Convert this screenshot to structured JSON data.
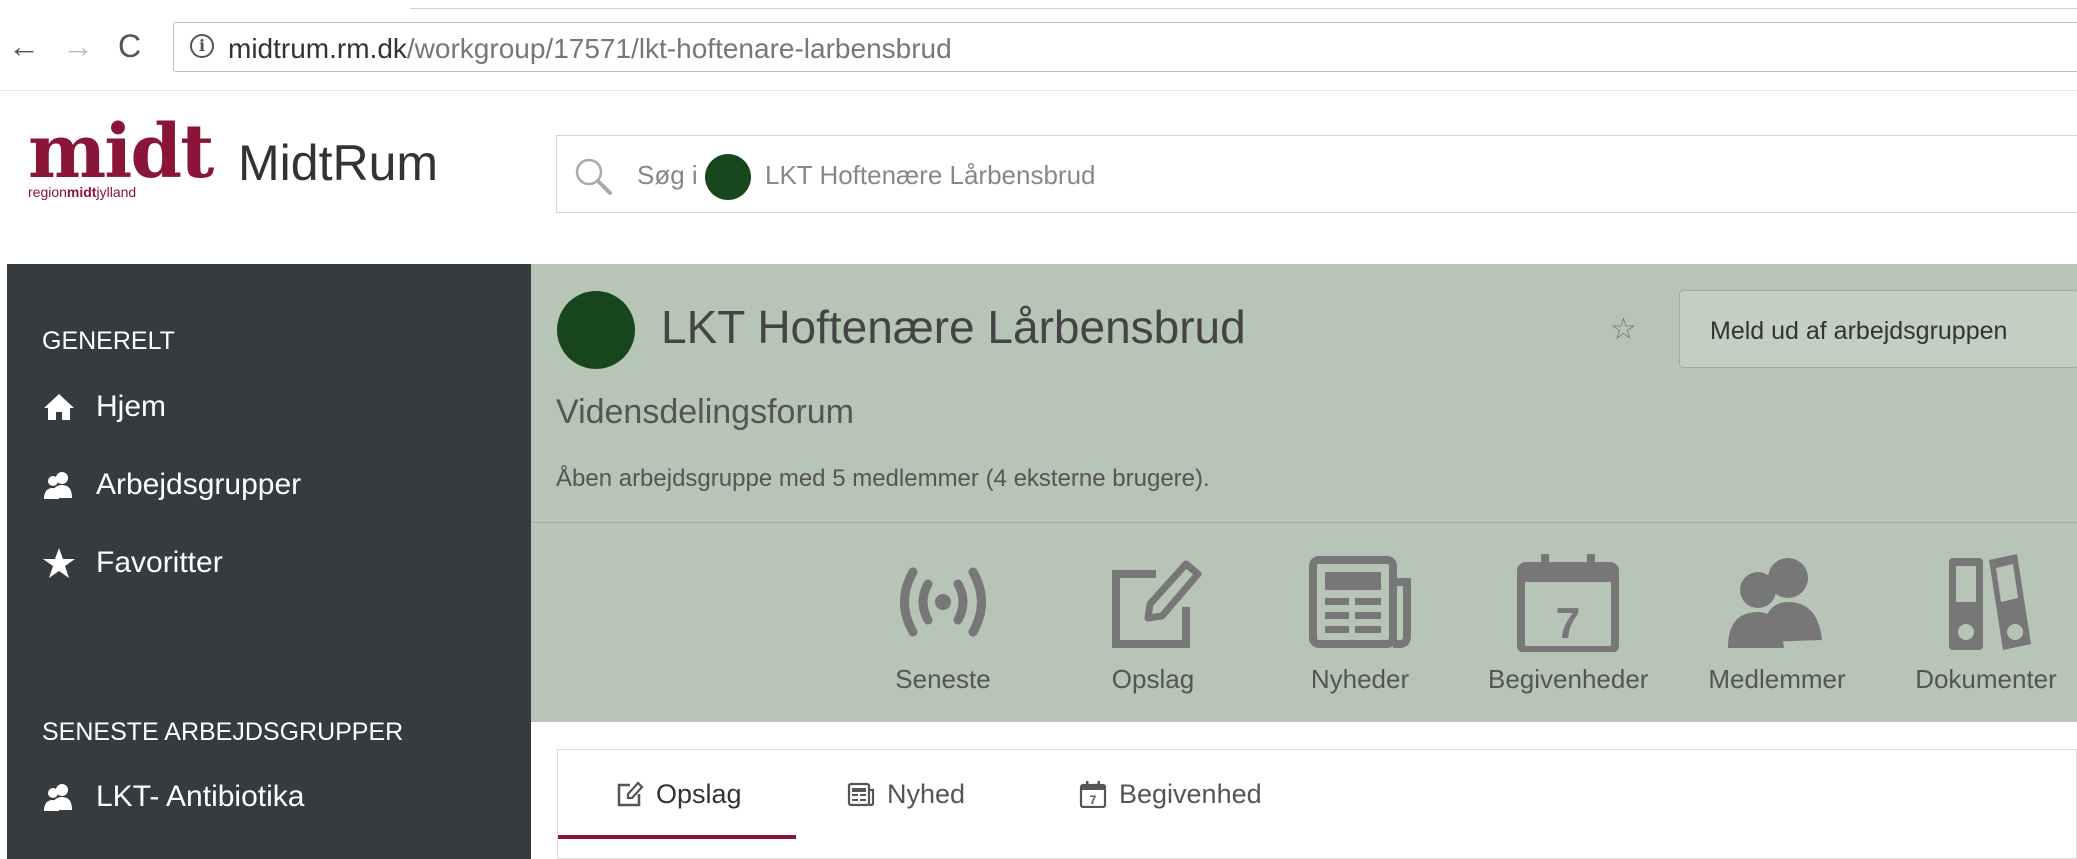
{
  "browser": {
    "url_domain": "midtrum.rm.dk",
    "url_path": "/workgroup/17571/lkt-hoftenare-larbensbrud"
  },
  "header": {
    "logo_mark": "midt",
    "logo_sub_prefix": "region",
    "logo_sub_bold": "midt",
    "logo_sub_suffix": "jylland",
    "brand": "MidtRum",
    "search_prefix": "Søg i",
    "search_group": "LKT Hoftenære Lårbensbrud"
  },
  "sidebar": {
    "general_heading": "GENERELT",
    "items": [
      {
        "label": "Hjem",
        "icon": "home-icon"
      },
      {
        "label": "Arbejdsgrupper",
        "icon": "workgroup-icon"
      },
      {
        "label": "Favoritter",
        "icon": "star-icon"
      }
    ],
    "recent_heading": "SENESTE ARBEJDSGRUPPER",
    "recent_items": [
      {
        "label": "LKT- Antibiotika",
        "icon": "workgroup-icon"
      }
    ]
  },
  "group": {
    "title": "LKT Hoftenære Lårbensbrud",
    "favorite_glyph": "☆",
    "leave_button": "Meld ud af arbejdsgruppen",
    "subtitle": "Vidensdelingsforum",
    "description": "Åben arbejdsgruppe med 5 medlemmer (4 eksterne brugere).",
    "tools": [
      {
        "label": "Seneste",
        "icon": "broadcast-icon"
      },
      {
        "label": "Opslag",
        "icon": "edit-icon"
      },
      {
        "label": "Nyheder",
        "icon": "newspaper-icon"
      },
      {
        "label": "Begivenheder",
        "icon": "calendar-icon"
      },
      {
        "label": "Medlemmer",
        "icon": "members-icon"
      },
      {
        "label": "Dokumenter",
        "icon": "binders-icon"
      }
    ],
    "calendar_day": "7"
  },
  "tabs": [
    {
      "label": "Opslag",
      "icon": "edit-icon",
      "active": true
    },
    {
      "label": "Nyhed",
      "icon": "newspaper-icon",
      "active": false
    },
    {
      "label": "Begivenhed",
      "icon": "calendar-icon",
      "active": false
    }
  ],
  "colors": {
    "brand": "#8a1538",
    "sidebar_bg": "#363b40",
    "band_bg": "#b7c5b7",
    "group_avatar": "#17461d"
  }
}
